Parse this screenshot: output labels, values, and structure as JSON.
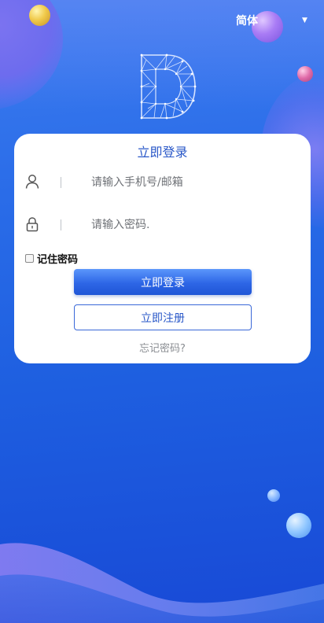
{
  "language": {
    "selected": "简体"
  },
  "logo": {
    "letter": "D"
  },
  "login_card": {
    "title": "立即登录",
    "username": {
      "placeholder": "请输入手机号/邮箱",
      "value": ""
    },
    "password": {
      "placeholder": "请输入密码.",
      "value": ""
    },
    "remember": {
      "label": "记住密码",
      "checked": false
    },
    "login_button": "立即登录",
    "register_button": "立即注册",
    "forgot_link": "忘记密码?"
  },
  "colors": {
    "primary": "#2a58c8",
    "button_gradient_top": "#5b96fb",
    "button_gradient_bottom": "#1f55d6",
    "background": "#1e5fe0"
  },
  "icons": {
    "username_icon": "user-icon",
    "password_icon": "lock-icon",
    "language_arrow": "dropdown-arrow-icon"
  }
}
